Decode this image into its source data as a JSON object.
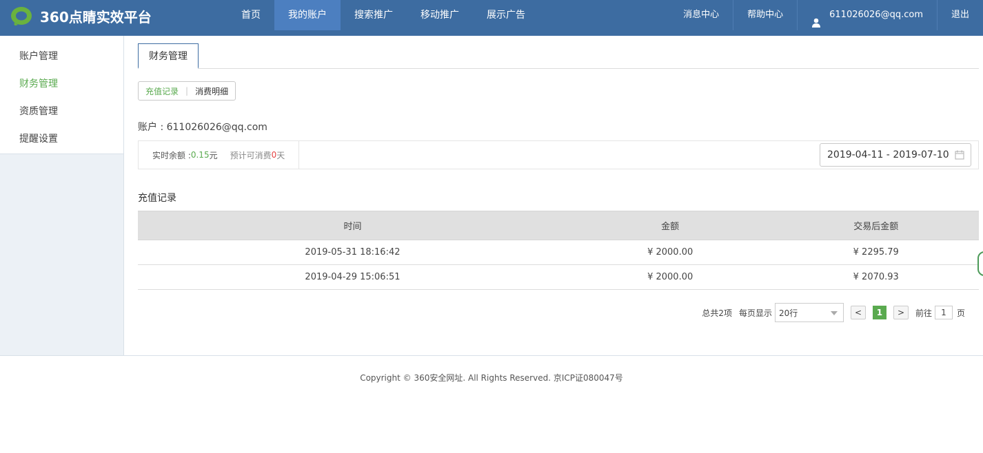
{
  "app": {
    "logo_text": "360点睛实效平台"
  },
  "nav": {
    "items": [
      {
        "label": "首页",
        "active": false
      },
      {
        "label": "我的账户",
        "active": true
      },
      {
        "label": "搜索推广",
        "active": false
      },
      {
        "label": "移动推广",
        "active": false
      },
      {
        "label": "展示广告",
        "active": false
      }
    ]
  },
  "topright": {
    "messages": "消息中心",
    "help": "帮助中心",
    "user": "611026026@qq.com",
    "logout": "退出"
  },
  "sidebar": {
    "items": [
      {
        "label": "账户管理",
        "active": false
      },
      {
        "label": "财务管理",
        "active": true
      },
      {
        "label": "资质管理",
        "active": false
      },
      {
        "label": "提醒设置",
        "active": false
      }
    ]
  },
  "main": {
    "tab": "财务管理",
    "segment": {
      "recharge": "充值记录",
      "sep": "|",
      "consume": "消费明细"
    },
    "account": "账户 : 611026026@qq.com",
    "balance": {
      "label": "实时余额 : ",
      "value": "0.15",
      "unit": "元",
      "forecast_prefix": "预计可消费",
      "forecast_days": "0",
      "forecast_suffix": "天"
    },
    "date_range": "2019-04-11 - 2019-07-10",
    "section_title": "充值记录",
    "table": {
      "headers": [
        "时间",
        "金额",
        "交易后金额"
      ],
      "rows": [
        [
          "2019-05-31 18:16:42",
          "¥ 2000.00",
          "¥ 2295.79"
        ],
        [
          "2019-04-29 15:06:51",
          "¥ 2000.00",
          "¥ 2070.93"
        ]
      ]
    },
    "pager": {
      "total": "总共2项",
      "per_page_label": "每页显示",
      "per_page_value": "20行",
      "prev": "<",
      "current": "1",
      "next": ">",
      "goto_label": "前往",
      "goto_value": "1",
      "page_suffix": "页"
    }
  },
  "footer": "Copyright © 360安全网址. All Rights Reserved. 京ICP证080047号",
  "colors": {
    "topbar": "#3d6ca1",
    "nav_active": "#4c7fc0",
    "accent_green": "#5aaa4f",
    "alert_red": "#e34242"
  }
}
